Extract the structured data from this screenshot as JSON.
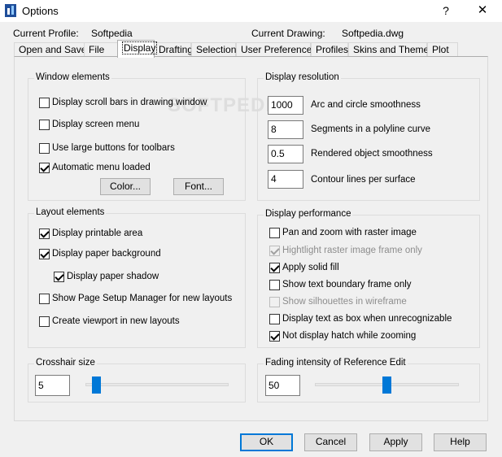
{
  "window": {
    "title": "Options",
    "help_glyph": "?",
    "close_glyph": "✕"
  },
  "info": {
    "profile_label": "Current Profile:",
    "profile_value": "Softpedia",
    "drawing_label": "Current Drawing:",
    "drawing_value": "Softpedia.dwg"
  },
  "tabs": [
    {
      "label": "Open and Save"
    },
    {
      "label": "File"
    },
    {
      "label": "Display",
      "active": true
    },
    {
      "label": "Drafting"
    },
    {
      "label": "Selection"
    },
    {
      "label": "User Preferences"
    },
    {
      "label": "Profiles"
    },
    {
      "label": "Skins and Themes"
    },
    {
      "label": "Plot"
    }
  ],
  "watermark": "SOFTPEDIA",
  "window_elements": {
    "title": "Window elements",
    "options": [
      {
        "label": "Display scroll bars in drawing window",
        "checked": false
      },
      {
        "label": "Display screen menu",
        "checked": false
      },
      {
        "label": "Use large buttons for toolbars",
        "checked": false
      },
      {
        "label": "Automatic menu loaded",
        "checked": true
      }
    ],
    "color_button": "Color...",
    "font_button": "Font..."
  },
  "display_resolution": {
    "title": "Display resolution",
    "items": [
      {
        "value": "1000",
        "label": "Arc and circle smoothness"
      },
      {
        "value": "8",
        "label": "Segments in a polyline curve"
      },
      {
        "value": "0.5",
        "label": "Rendered object smoothness"
      },
      {
        "value": "4",
        "label": "Contour lines per surface"
      }
    ]
  },
  "layout_elements": {
    "title": "Layout elements",
    "options": [
      {
        "label": "Display printable area",
        "checked": true
      },
      {
        "label": "Display paper background",
        "checked": true
      },
      {
        "label": "Display paper shadow",
        "checked": true
      },
      {
        "label": "Show Page Setup Manager for new layouts",
        "checked": false
      },
      {
        "label": "Create viewport in new layouts",
        "checked": false
      }
    ]
  },
  "display_performance": {
    "title": "Display performance",
    "options": [
      {
        "label": "Pan and zoom with raster image",
        "checked": false,
        "disabled": false
      },
      {
        "label": "Hightlight raster image frame only",
        "checked": true,
        "disabled": true
      },
      {
        "label": "Apply solid fill",
        "checked": true,
        "disabled": false
      },
      {
        "label": "Show text boundary frame only",
        "checked": false,
        "disabled": false
      },
      {
        "label": "Show silhouettes in wireframe",
        "checked": false,
        "disabled": true
      },
      {
        "label": "Display text as box when unrecognizable",
        "checked": false,
        "disabled": false
      },
      {
        "label": "Not display hatch while zooming",
        "checked": true,
        "disabled": false
      }
    ]
  },
  "crosshair": {
    "title": "Crosshair size",
    "value": "5",
    "slider_fraction": 0.05
  },
  "fading": {
    "title": "Fading intensity of Reference Edit",
    "value": "50",
    "slider_fraction": 0.5
  },
  "footer": {
    "ok": "OK",
    "cancel": "Cancel",
    "apply": "Apply",
    "help": "Help"
  }
}
